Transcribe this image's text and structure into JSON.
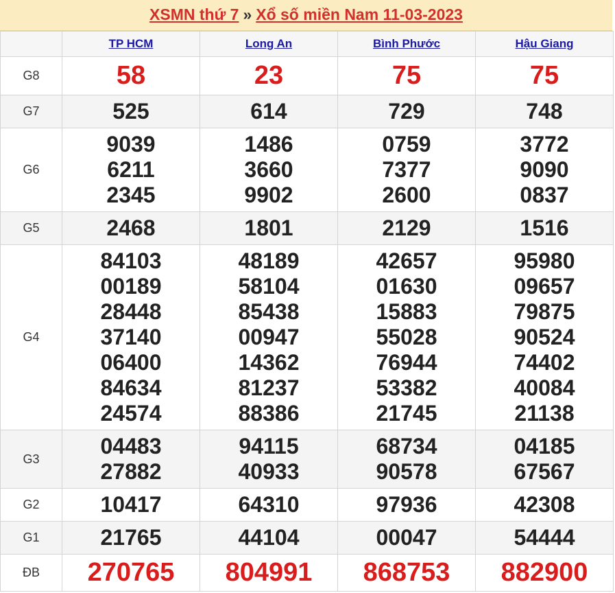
{
  "header": {
    "link1": "XSMN thứ 7",
    "separator": "»",
    "link2": "Xổ số miền Nam 11-03-2023"
  },
  "provinces": [
    "TP HCM",
    "Long An",
    "Bình Phước",
    "Hậu Giang"
  ],
  "prizes": [
    {
      "label": "G8",
      "values": [
        [
          "58"
        ],
        [
          "23"
        ],
        [
          "75"
        ],
        [
          "75"
        ]
      ]
    },
    {
      "label": "G7",
      "values": [
        [
          "525"
        ],
        [
          "614"
        ],
        [
          "729"
        ],
        [
          "748"
        ]
      ]
    },
    {
      "label": "G6",
      "values": [
        [
          "9039",
          "6211",
          "2345"
        ],
        [
          "1486",
          "3660",
          "9902"
        ],
        [
          "0759",
          "7377",
          "2600"
        ],
        [
          "3772",
          "9090",
          "0837"
        ]
      ]
    },
    {
      "label": "G5",
      "values": [
        [
          "2468"
        ],
        [
          "1801"
        ],
        [
          "2129"
        ],
        [
          "1516"
        ]
      ]
    },
    {
      "label": "G4",
      "values": [
        [
          "84103",
          "00189",
          "28448",
          "37140",
          "06400",
          "84634",
          "24574"
        ],
        [
          "48189",
          "58104",
          "85438",
          "00947",
          "14362",
          "81237",
          "88386"
        ],
        [
          "42657",
          "01630",
          "15883",
          "55028",
          "76944",
          "53382",
          "21745"
        ],
        [
          "95980",
          "09657",
          "79875",
          "90524",
          "74402",
          "40084",
          "21138"
        ]
      ]
    },
    {
      "label": "G3",
      "values": [
        [
          "04483",
          "27882"
        ],
        [
          "94115",
          "40933"
        ],
        [
          "68734",
          "90578"
        ],
        [
          "04185",
          "67567"
        ]
      ]
    },
    {
      "label": "G2",
      "values": [
        [
          "10417"
        ],
        [
          "64310"
        ],
        [
          "97936"
        ],
        [
          "42308"
        ]
      ]
    },
    {
      "label": "G1",
      "values": [
        [
          "21765"
        ],
        [
          "44104"
        ],
        [
          "00047"
        ],
        [
          "54444"
        ]
      ]
    },
    {
      "label": "ĐB",
      "values": [
        [
          "270765"
        ],
        [
          "804991"
        ],
        [
          "868753"
        ],
        [
          "882900"
        ]
      ]
    }
  ],
  "colors": {
    "header_bg": "#fbedc1",
    "link_red": "#d0312d",
    "province_link": "#1a1aa6",
    "highlight_red": "#d91c1c"
  }
}
